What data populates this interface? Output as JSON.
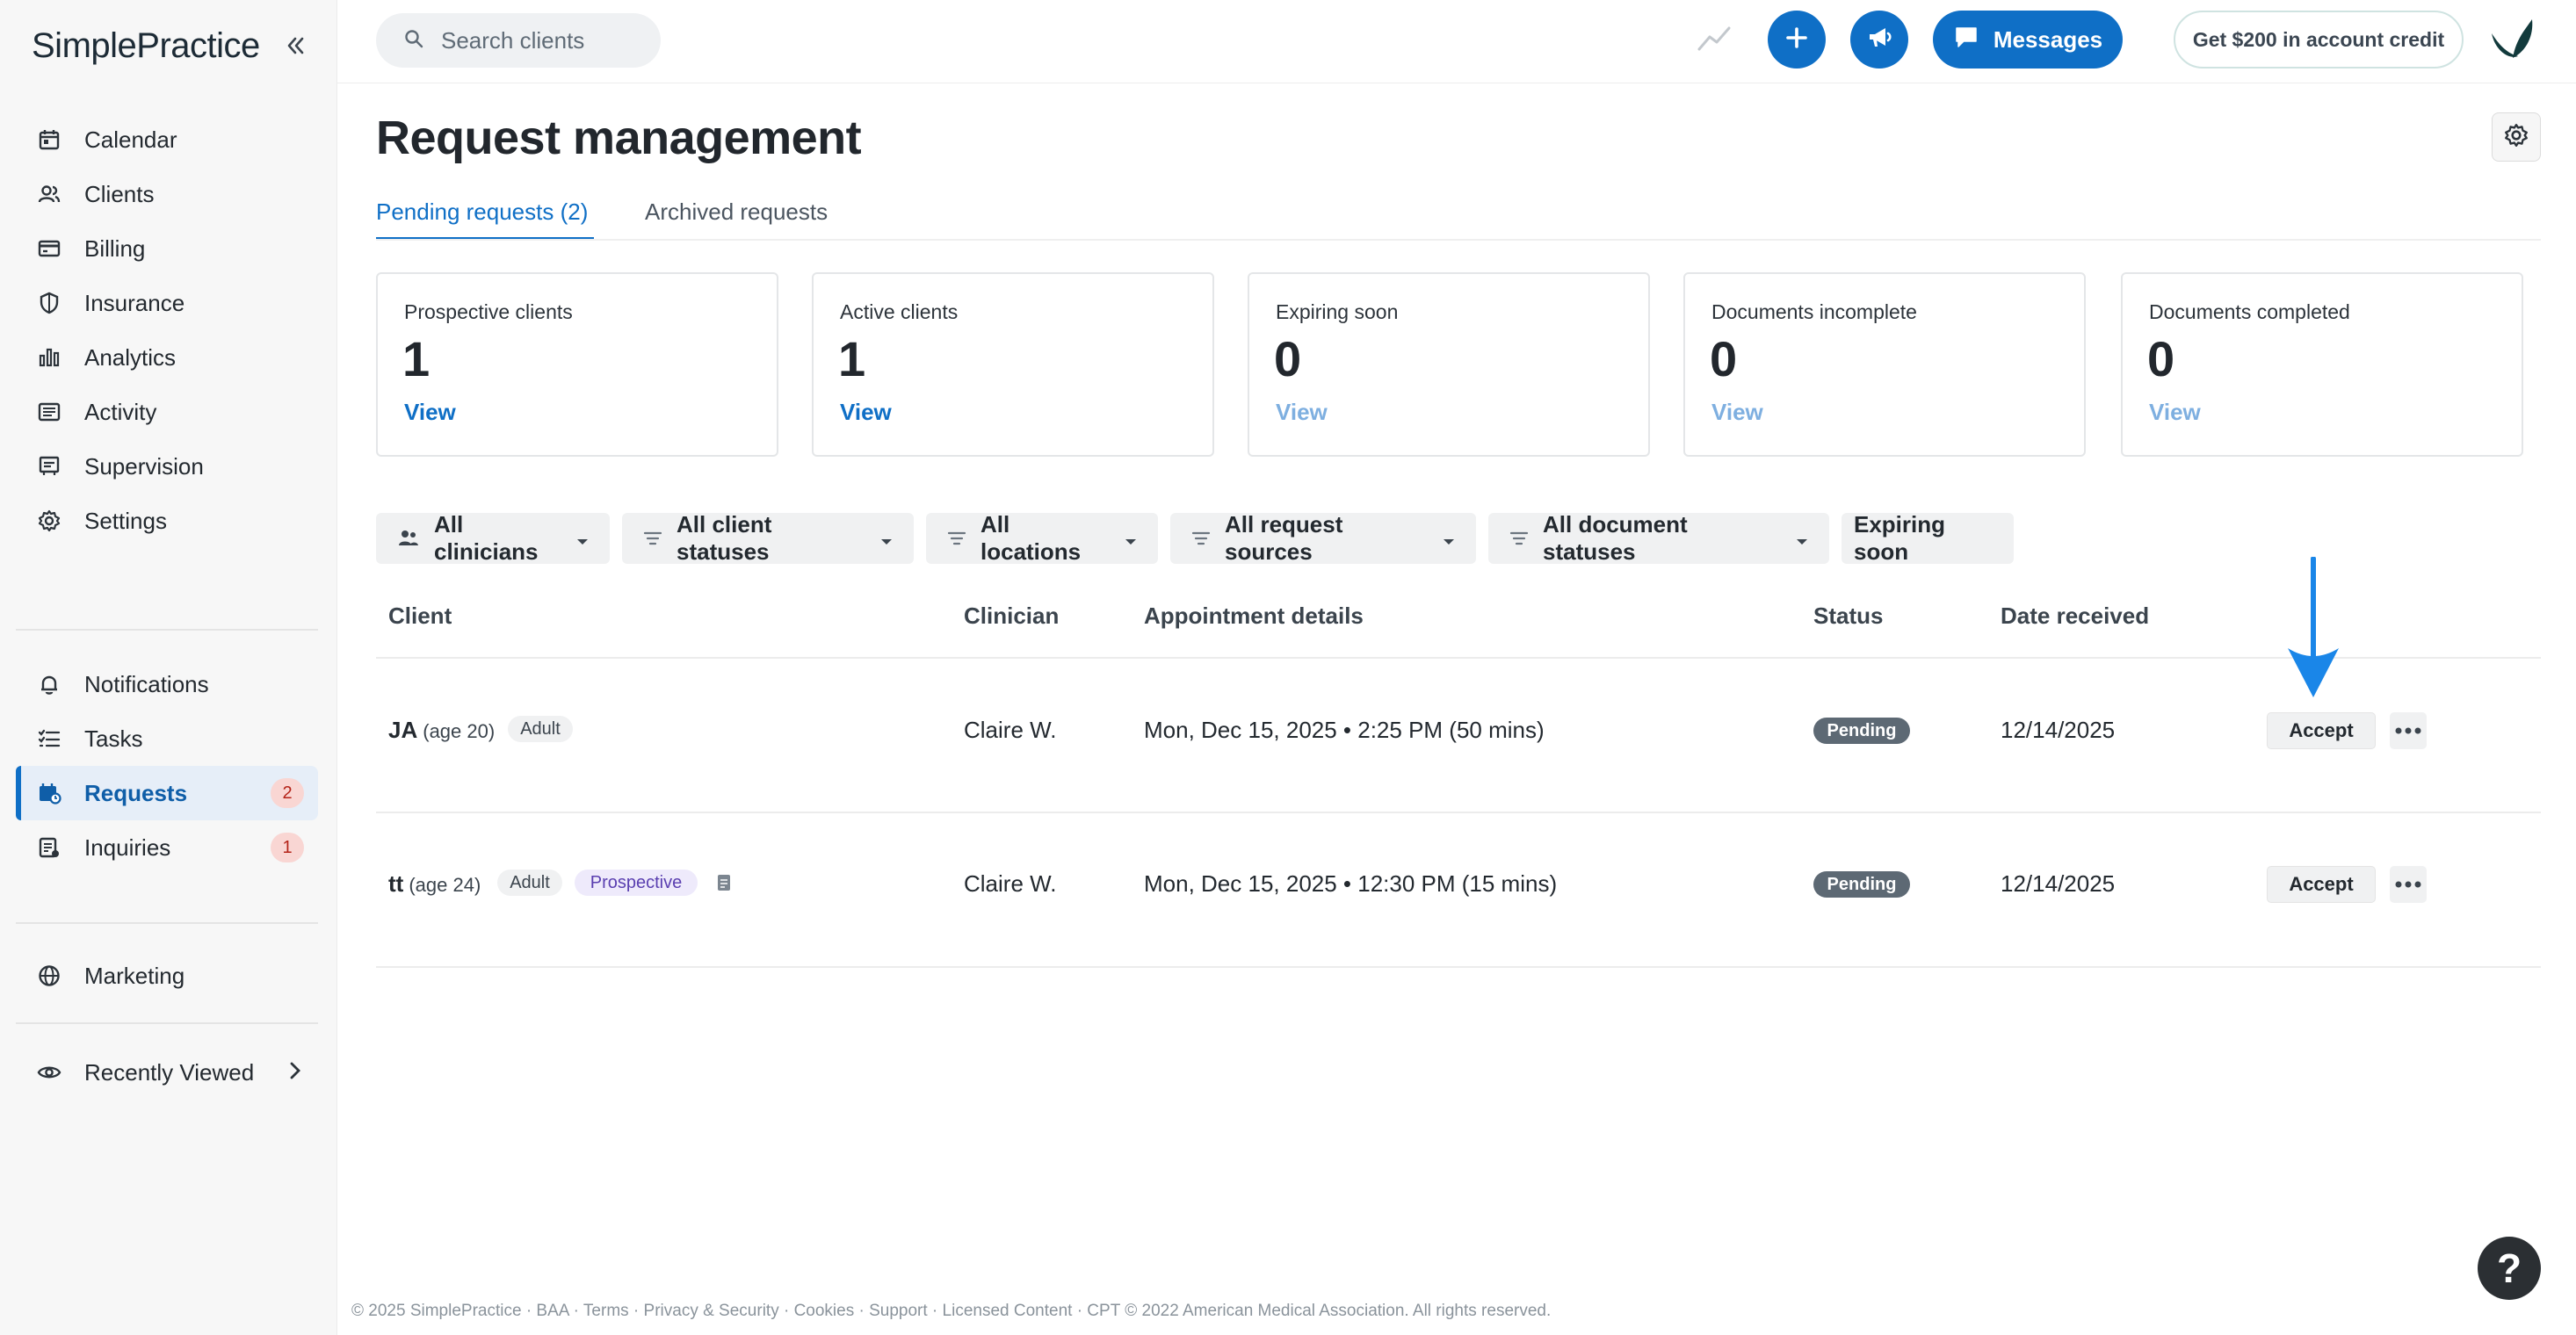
{
  "brand": {
    "name": "SimplePractice"
  },
  "sidebar": {
    "items": [
      {
        "label": "Calendar",
        "icon": "calendar-icon"
      },
      {
        "label": "Clients",
        "icon": "clients-icon"
      },
      {
        "label": "Billing",
        "icon": "billing-icon"
      },
      {
        "label": "Insurance",
        "icon": "shield-icon"
      },
      {
        "label": "Analytics",
        "icon": "analytics-icon"
      },
      {
        "label": "Activity",
        "icon": "activity-icon"
      },
      {
        "label": "Supervision",
        "icon": "supervision-icon"
      },
      {
        "label": "Settings",
        "icon": "gear-icon"
      },
      {
        "label": "Notifications",
        "icon": "bell-icon"
      },
      {
        "label": "Tasks",
        "icon": "tasks-icon"
      },
      {
        "label": "Requests",
        "icon": "requests-icon",
        "badge": "2",
        "active": true
      },
      {
        "label": "Inquiries",
        "icon": "inquiries-icon",
        "badge": "1"
      },
      {
        "label": "Marketing",
        "icon": "globe-icon"
      },
      {
        "label": "Recently Viewed",
        "icon": "eye-icon"
      }
    ]
  },
  "topbar": {
    "search_placeholder": "Search clients",
    "messages_label": "Messages",
    "credit_label": "Get $200 in account credit"
  },
  "main": {
    "title": "Request management",
    "tabs": [
      {
        "label": "Pending requests (2)",
        "active": true
      },
      {
        "label": "Archived requests",
        "active": false
      }
    ],
    "cards": [
      {
        "label": "Prospective clients",
        "value": "1",
        "link": "View"
      },
      {
        "label": "Active clients",
        "value": "1",
        "link": "View"
      },
      {
        "label": "Expiring soon",
        "value": "0",
        "link": "View"
      },
      {
        "label": "Documents incomplete",
        "value": "0",
        "link": "View"
      },
      {
        "label": "Documents completed",
        "value": "0",
        "link": "View"
      }
    ],
    "filters": [
      "All clinicians",
      "All client statuses",
      "All locations",
      "All request sources",
      "All document statuses",
      "Expiring soon"
    ],
    "table": {
      "headers": [
        "Client",
        "Clinician",
        "Appointment details",
        "Status",
        "Date received"
      ],
      "rows": [
        {
          "client": "JA",
          "age": "(age 20)",
          "tags": [
            "Adult"
          ],
          "clinician": "Claire W.",
          "appointment": "Mon, Dec 15, 2025 • 2:25 PM (50 mins)",
          "status": "Pending",
          "date": "12/14/2025",
          "action": "Accept"
        },
        {
          "client": "tt",
          "age": "(age 24)",
          "tags": [
            "Adult",
            "Prospective"
          ],
          "clinician": "Claire W.",
          "appointment": "Mon, Dec 15, 2025 • 12:30 PM (15 mins)",
          "status": "Pending",
          "date": "12/14/2025",
          "action": "Accept"
        }
      ]
    }
  },
  "footer": {
    "text": "© 2025 SimplePractice · BAA · Terms · Privacy & Security · Cookies · Support · Licensed Content · CPT © 2022 American Medical Association. All rights reserved."
  },
  "help": {
    "label": "?"
  },
  "colors": {
    "accent": "#0f6fc6",
    "status_pending": "#5d6974",
    "badge_bg": "#f9d6d3"
  }
}
